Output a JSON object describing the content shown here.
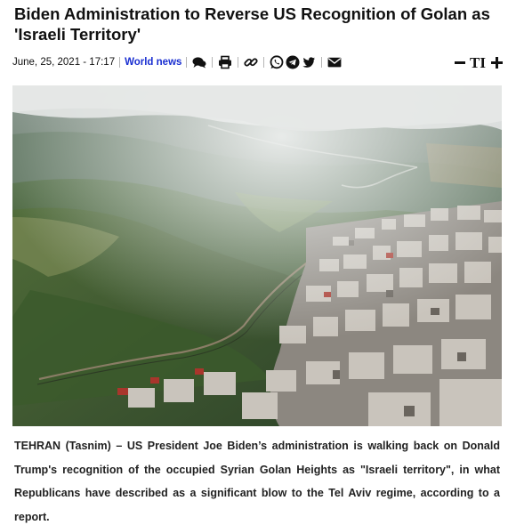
{
  "article": {
    "title": "Biden Administration to Reverse US Recognition of Golan as 'Israeli Territory'",
    "date": "June, 25, 2021 - 17:17",
    "category": "World news",
    "lead": "TEHRAN (Tasnim) – US President Joe Biden’s administration is walking back on Donald Trump's recognition of the occupied Syrian Golan Heights as \"Israeli territory\", in what Republicans have described as a significant blow to the Tel Aviv regime, according to a report."
  },
  "share_icons": [
    "comment-icon",
    "print-icon",
    "link-icon",
    "whatsapp-icon",
    "telegram-icon",
    "twitter-icon",
    "email-icon"
  ],
  "font_tools": {
    "decrease_icon": "minus-icon",
    "size_label": "TI",
    "increase_icon": "plus-icon"
  },
  "colors": {
    "category_link": "#1a2fd1",
    "text": "#111111"
  }
}
